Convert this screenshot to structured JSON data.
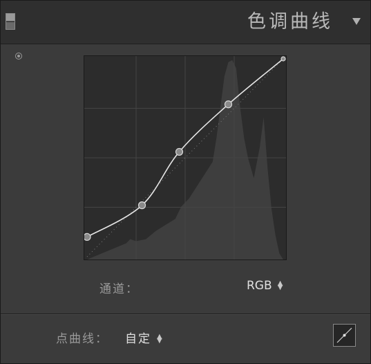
{
  "header": {
    "title": "色调曲线"
  },
  "icons": {
    "panel_toggle": "panel-switch-icon",
    "collapse": "triangle-down-icon",
    "target_adjust": "target-adjust-icon",
    "stepper": "up-down-stepper-icon",
    "curve_mode": "parametric-curve-icon"
  },
  "channel": {
    "label": "通道：",
    "value": "RGB"
  },
  "point_curve": {
    "label": "点曲线：",
    "value": "自定"
  },
  "curve": {
    "points": [
      {
        "input": 0,
        "output": 10
      },
      {
        "input": 28,
        "output": 26
      },
      {
        "input": 47,
        "output": 53
      },
      {
        "input": 72,
        "output": 77
      },
      {
        "input": 100,
        "output": 100
      }
    ]
  },
  "colors": {
    "curve_line": "#e6e6e6",
    "grid": "#444444",
    "histogram": "#3e3e3e",
    "point_fill": "#8a8a8a"
  }
}
